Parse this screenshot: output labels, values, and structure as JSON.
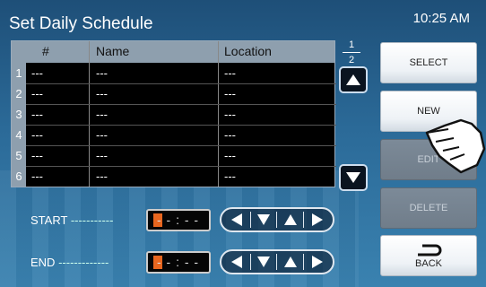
{
  "header": {
    "title": "Set Daily Schedule",
    "clock": "10:25 AM"
  },
  "table": {
    "columns": [
      "#",
      "Name",
      "Location"
    ],
    "rows": [
      {
        "index": "1",
        "num": "---",
        "name": "---",
        "location": "---"
      },
      {
        "index": "2",
        "num": "---",
        "name": "---",
        "location": "---"
      },
      {
        "index": "3",
        "num": "---",
        "name": "---",
        "location": "---"
      },
      {
        "index": "4",
        "num": "---",
        "name": "---",
        "location": "---"
      },
      {
        "index": "5",
        "num": "---",
        "name": "---",
        "location": "---"
      },
      {
        "index": "6",
        "num": "---",
        "name": "---",
        "location": "---"
      }
    ]
  },
  "pagination": {
    "current": "1",
    "total": "2"
  },
  "time_settings": {
    "start": {
      "label": "START",
      "dashes": "-----------",
      "value": "- - : - -"
    },
    "end": {
      "label": "END",
      "dashes": "-------------",
      "value": "- - : - -"
    }
  },
  "side_buttons": {
    "select": "SELECT",
    "new": "NEW",
    "edit": "EDIT",
    "delete": "DELETE",
    "back": "BACK"
  },
  "icons": {
    "scroll_up": "triangle-up-icon",
    "scroll_down": "triangle-down-icon",
    "back": "return-arrow-icon",
    "hand": "pointing-hand-icon"
  },
  "colors": {
    "accent": "#e8661f",
    "background": "#2b6a98"
  }
}
